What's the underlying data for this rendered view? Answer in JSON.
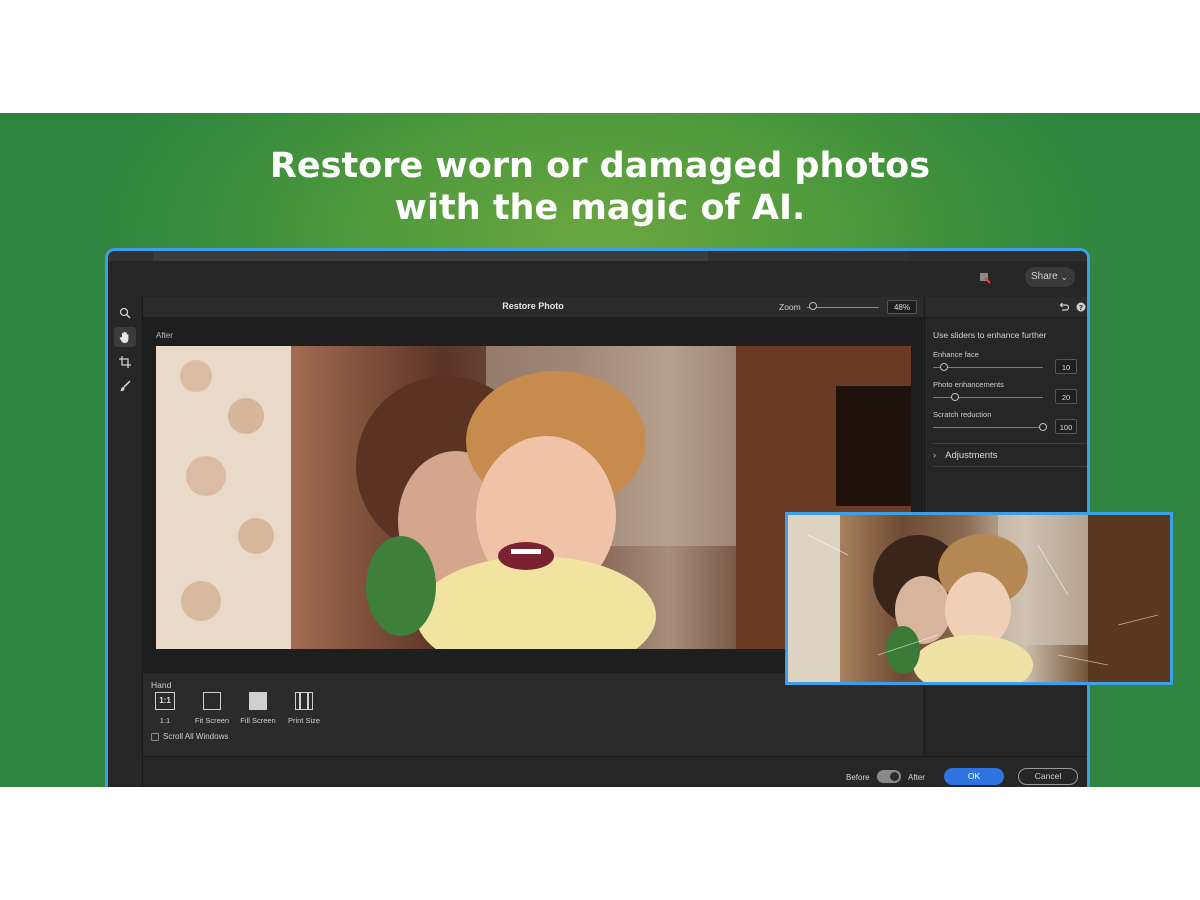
{
  "banner": {
    "headline_line1": "Restore worn or damaged photos",
    "headline_line2": "with the magic of AI."
  },
  "appbar": {
    "share_label": "Share"
  },
  "dialog": {
    "title": "Restore Photo",
    "zoom_label": "Zoom",
    "zoom_value": "48%",
    "zoom_level_percent": 48,
    "canvas_label": "After"
  },
  "right_panel": {
    "hint": "Use sliders to enhance further",
    "sliders": [
      {
        "label": "Enhance face",
        "value": "10",
        "level": 0.1
      },
      {
        "label": "Photo enhancements",
        "value": "20",
        "level": 0.2
      },
      {
        "label": "Scratch reduction",
        "value": "100",
        "level": 1.0
      }
    ],
    "adjustments_label": "Adjustments"
  },
  "bottom_tools": {
    "tool_name": "Hand",
    "options": [
      {
        "label": "1:1",
        "icon_text": "1:1"
      },
      {
        "label": "Fit Screen"
      },
      {
        "label": "Fill Screen"
      },
      {
        "label": "Print Size"
      }
    ],
    "scroll_all_label": "Scroll All Windows"
  },
  "footer": {
    "before_label": "Before",
    "after_label": "After",
    "ok_label": "OK",
    "cancel_label": "Cancel"
  },
  "colors": {
    "accent_blue": "#2f73e0",
    "frame_blue": "#3c9fe8",
    "banner_green": "#4f9a3c"
  }
}
